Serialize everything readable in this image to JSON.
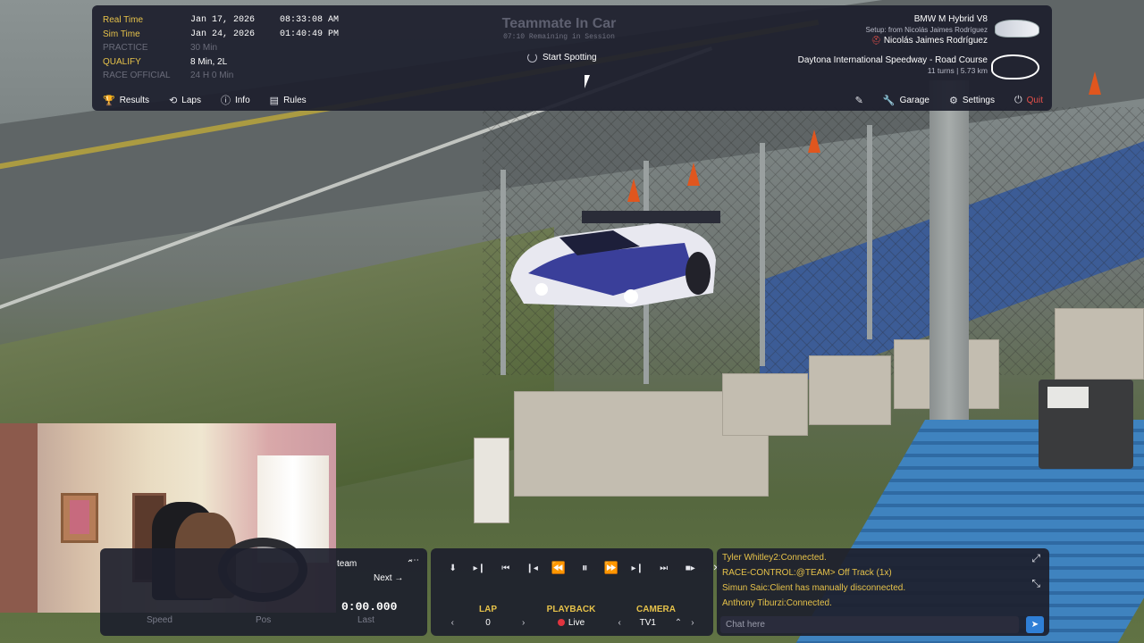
{
  "session_table": [
    {
      "label": "Real Time",
      "date": "Jan 17, 2026",
      "time": "08:33:08 AM"
    },
    {
      "label": "Sim Time",
      "date": "Jan 24, 2026",
      "time": "01:40:49 PM"
    },
    {
      "label": "PRACTICE",
      "value": "30 Min"
    },
    {
      "label": "QUALIFY",
      "value": "8 Min, 2L"
    },
    {
      "label": "RACE",
      "label2": "OFFICIAL",
      "value": "24 H 0 Min"
    }
  ],
  "header": {
    "title": "Teammate In Car",
    "subtitle": "07:10 Remaining in Session",
    "spot_button": "Start Spotting"
  },
  "car": {
    "name": "BMW M Hybrid V8",
    "setup": "Setup: from Nicolás Jaimes Rodríguez",
    "driver": "Nicolás Jaimes Rodríguez",
    "track": "Daytona International Speedway - Road Course",
    "turns": "11 turns",
    "length": "5.73 km"
  },
  "hud_nav": {
    "results": "Results",
    "laps": "Laps",
    "info": "Info",
    "rules": "Rules",
    "garage": "Garage",
    "settings": "Settings",
    "quit": "Quit"
  },
  "left_panel": {
    "team": "team",
    "next": "Next",
    "time": "0:00.000",
    "labels": [
      "Speed",
      "Pos",
      "Last"
    ]
  },
  "playback": {
    "lap_label": "LAP",
    "lap_value": "0",
    "playback_label": "PLAYBACK",
    "playback_value": "Live",
    "camera_label": "CAMERA",
    "camera_value": "TV1"
  },
  "chat": {
    "messages": [
      "Tyler Whitley2:Connected.",
      "RACE-CONTROL:@TEAM> Off Track (1x)",
      "Simun Saic:Client has manually disconnected.",
      "Anthony Tiburzi:Connected."
    ],
    "placeholder": "Chat here"
  },
  "colors": {
    "accent": "#e6c24a",
    "panel": "#1d1f2d",
    "live": "#e0343f",
    "quit": "#e6504a",
    "send": "#2f7fd6"
  }
}
